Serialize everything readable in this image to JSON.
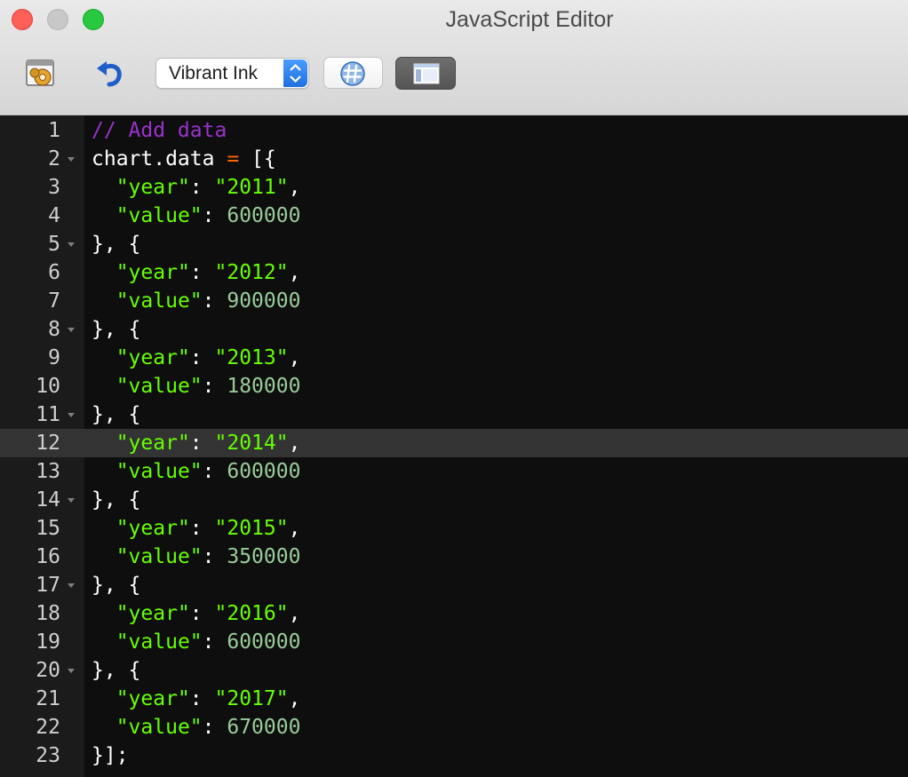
{
  "window": {
    "title": "JavaScript Editor"
  },
  "toolbar": {
    "theme_value": "Vibrant Ink",
    "settings_icon": "gear-window-icon",
    "undo_icon": "undo-arrow-icon",
    "hash_icon": "hash-icon",
    "layout_icon": "panel-layout-icon"
  },
  "theme_colors": {
    "comment": "#9933CC",
    "plain": "#FFFFFF",
    "operator": "#FF6600",
    "string": "#66FF00",
    "number": "#99CC99"
  },
  "editor": {
    "active_line": 12,
    "lines": [
      {
        "n": "1",
        "fold": false,
        "tokens": [
          {
            "t": "comment",
            "v": "// Add data"
          }
        ]
      },
      {
        "n": "2",
        "fold": true,
        "tokens": [
          {
            "t": "plain",
            "v": "chart.data "
          },
          {
            "t": "op",
            "v": "="
          },
          {
            "t": "plain",
            "v": " [{"
          }
        ]
      },
      {
        "n": "3",
        "fold": false,
        "tokens": [
          {
            "t": "plain",
            "v": "  "
          },
          {
            "t": "string",
            "v": "\"year\""
          },
          {
            "t": "plain",
            "v": ": "
          },
          {
            "t": "string",
            "v": "\"2011\""
          },
          {
            "t": "plain",
            "v": ","
          }
        ]
      },
      {
        "n": "4",
        "fold": false,
        "tokens": [
          {
            "t": "plain",
            "v": "  "
          },
          {
            "t": "string",
            "v": "\"value\""
          },
          {
            "t": "plain",
            "v": ": "
          },
          {
            "t": "number",
            "v": "600000"
          }
        ]
      },
      {
        "n": "5",
        "fold": true,
        "tokens": [
          {
            "t": "plain",
            "v": "}, {"
          }
        ]
      },
      {
        "n": "6",
        "fold": false,
        "tokens": [
          {
            "t": "plain",
            "v": "  "
          },
          {
            "t": "string",
            "v": "\"year\""
          },
          {
            "t": "plain",
            "v": ": "
          },
          {
            "t": "string",
            "v": "\"2012\""
          },
          {
            "t": "plain",
            "v": ","
          }
        ]
      },
      {
        "n": "7",
        "fold": false,
        "tokens": [
          {
            "t": "plain",
            "v": "  "
          },
          {
            "t": "string",
            "v": "\"value\""
          },
          {
            "t": "plain",
            "v": ": "
          },
          {
            "t": "number",
            "v": "900000"
          }
        ]
      },
      {
        "n": "8",
        "fold": true,
        "tokens": [
          {
            "t": "plain",
            "v": "}, {"
          }
        ]
      },
      {
        "n": "9",
        "fold": false,
        "tokens": [
          {
            "t": "plain",
            "v": "  "
          },
          {
            "t": "string",
            "v": "\"year\""
          },
          {
            "t": "plain",
            "v": ": "
          },
          {
            "t": "string",
            "v": "\"2013\""
          },
          {
            "t": "plain",
            "v": ","
          }
        ]
      },
      {
        "n": "10",
        "fold": false,
        "tokens": [
          {
            "t": "plain",
            "v": "  "
          },
          {
            "t": "string",
            "v": "\"value\""
          },
          {
            "t": "plain",
            "v": ": "
          },
          {
            "t": "number",
            "v": "180000"
          }
        ]
      },
      {
        "n": "11",
        "fold": true,
        "tokens": [
          {
            "t": "plain",
            "v": "}, {"
          }
        ]
      },
      {
        "n": "12",
        "fold": false,
        "tokens": [
          {
            "t": "plain",
            "v": "  "
          },
          {
            "t": "string",
            "v": "\"year\""
          },
          {
            "t": "plain",
            "v": ": "
          },
          {
            "t": "string",
            "v": "\"2014\""
          },
          {
            "t": "plain",
            "v": ","
          }
        ]
      },
      {
        "n": "13",
        "fold": false,
        "tokens": [
          {
            "t": "plain",
            "v": "  "
          },
          {
            "t": "string",
            "v": "\"value\""
          },
          {
            "t": "plain",
            "v": ": "
          },
          {
            "t": "number",
            "v": "600000"
          }
        ]
      },
      {
        "n": "14",
        "fold": true,
        "tokens": [
          {
            "t": "plain",
            "v": "}, {"
          }
        ]
      },
      {
        "n": "15",
        "fold": false,
        "tokens": [
          {
            "t": "plain",
            "v": "  "
          },
          {
            "t": "string",
            "v": "\"year\""
          },
          {
            "t": "plain",
            "v": ": "
          },
          {
            "t": "string",
            "v": "\"2015\""
          },
          {
            "t": "plain",
            "v": ","
          }
        ]
      },
      {
        "n": "16",
        "fold": false,
        "tokens": [
          {
            "t": "plain",
            "v": "  "
          },
          {
            "t": "string",
            "v": "\"value\""
          },
          {
            "t": "plain",
            "v": ": "
          },
          {
            "t": "number",
            "v": "350000"
          }
        ]
      },
      {
        "n": "17",
        "fold": true,
        "tokens": [
          {
            "t": "plain",
            "v": "}, {"
          }
        ]
      },
      {
        "n": "18",
        "fold": false,
        "tokens": [
          {
            "t": "plain",
            "v": "  "
          },
          {
            "t": "string",
            "v": "\"year\""
          },
          {
            "t": "plain",
            "v": ": "
          },
          {
            "t": "string",
            "v": "\"2016\""
          },
          {
            "t": "plain",
            "v": ","
          }
        ]
      },
      {
        "n": "19",
        "fold": false,
        "tokens": [
          {
            "t": "plain",
            "v": "  "
          },
          {
            "t": "string",
            "v": "\"value\""
          },
          {
            "t": "plain",
            "v": ": "
          },
          {
            "t": "number",
            "v": "600000"
          }
        ]
      },
      {
        "n": "20",
        "fold": true,
        "tokens": [
          {
            "t": "plain",
            "v": "}, {"
          }
        ]
      },
      {
        "n": "21",
        "fold": false,
        "tokens": [
          {
            "t": "plain",
            "v": "  "
          },
          {
            "t": "string",
            "v": "\"year\""
          },
          {
            "t": "plain",
            "v": ": "
          },
          {
            "t": "string",
            "v": "\"2017\""
          },
          {
            "t": "plain",
            "v": ","
          }
        ]
      },
      {
        "n": "22",
        "fold": false,
        "tokens": [
          {
            "t": "plain",
            "v": "  "
          },
          {
            "t": "string",
            "v": "\"value\""
          },
          {
            "t": "plain",
            "v": ": "
          },
          {
            "t": "number",
            "v": "670000"
          }
        ]
      },
      {
        "n": "23",
        "fold": false,
        "tokens": [
          {
            "t": "plain",
            "v": "}];"
          }
        ]
      }
    ]
  }
}
